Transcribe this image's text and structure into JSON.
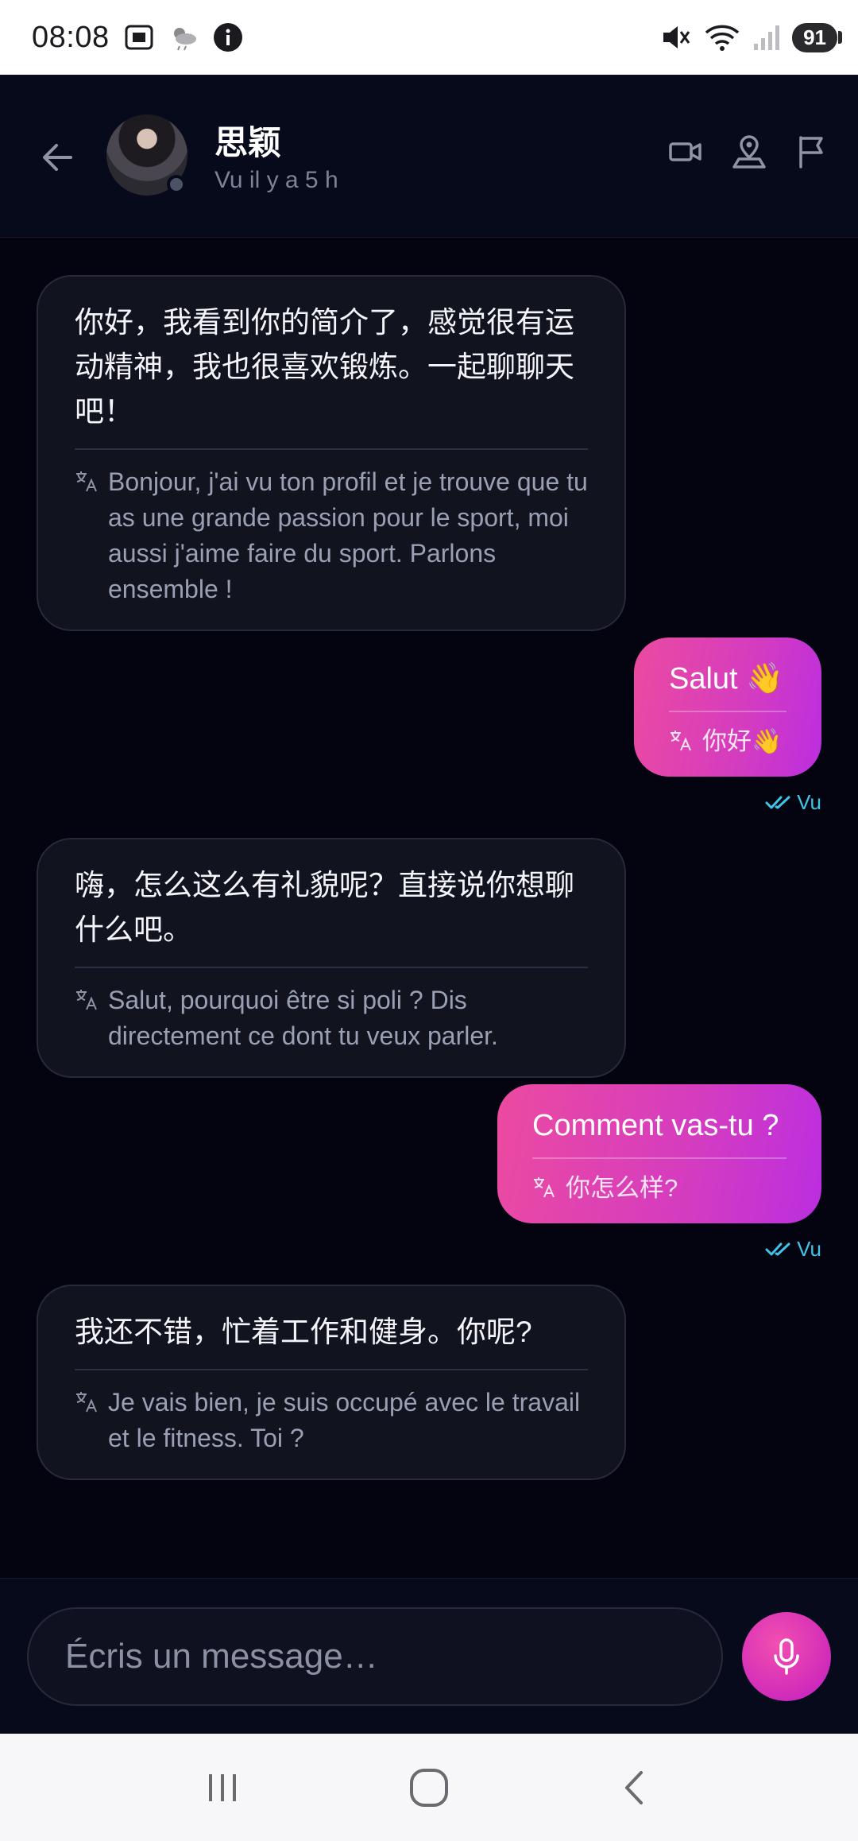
{
  "status_bar": {
    "time": "08:08",
    "battery": "91",
    "icons": [
      "screenshot-icon",
      "weather-icon",
      "info-icon",
      "mute-icon",
      "wifi-icon",
      "signal-icon",
      "battery-icon"
    ]
  },
  "header": {
    "contact_name": "思颖",
    "contact_status": "Vu il y a 5 h",
    "actions": [
      "video-call-icon",
      "location-icon",
      "report-flag-icon"
    ]
  },
  "messages": [
    {
      "direction": "in",
      "text": "你好，我看到你的简介了，感觉很有运动精神，我也很喜欢锻炼。一起聊聊天吧！",
      "translation": "Bonjour, j'ai vu ton profil et je trouve que tu as une grande passion pour le sport, moi aussi j'aime faire du sport. Parlons ensemble !"
    },
    {
      "direction": "out",
      "text": "Salut 👋",
      "translation": "你好👋",
      "receipt": "Vu"
    },
    {
      "direction": "in",
      "text": "嗨，怎么这么有礼貌呢？直接说你想聊什么吧。",
      "translation": "Salut, pourquoi être si poli ? Dis directement ce dont tu veux parler."
    },
    {
      "direction": "out",
      "text": "Comment vas-tu ?",
      "translation": "你怎么样?",
      "receipt": "Vu"
    },
    {
      "direction": "in",
      "text": "我还不错，忙着工作和健身。你呢?",
      "translation": "Je vais bien, je suis occupé avec le travail et le fitness. Toi ?"
    }
  ],
  "composer": {
    "placeholder": "Écris un message…"
  },
  "colors": {
    "background": "#03040f",
    "incoming_bubble": "#11131f",
    "outgoing_gradient_start": "#ec4aa0",
    "outgoing_gradient_end": "#bb2ee0",
    "read_receipt": "#3fc5e8"
  }
}
